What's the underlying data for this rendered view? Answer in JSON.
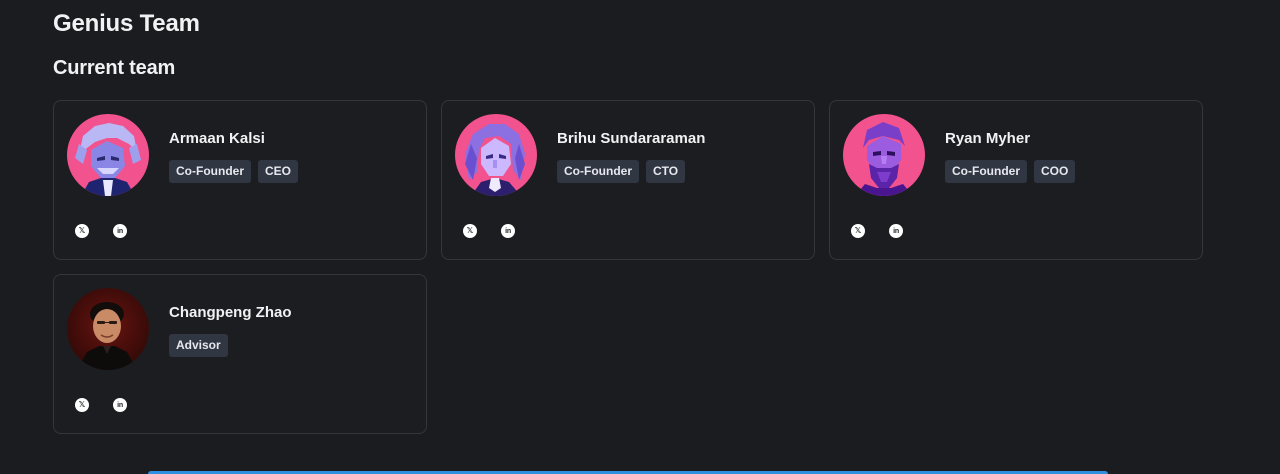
{
  "section_title": "Genius Team",
  "subsection_title": "Current team",
  "team": [
    {
      "name": "Armaan Kalsi",
      "tags": [
        "Co-Founder",
        "CEO"
      ],
      "avatar": "einstein-avatar",
      "socials": [
        "x-icon",
        "linkedin-icon"
      ]
    },
    {
      "name": "Brihu Sundararaman",
      "tags": [
        "Co-Founder",
        "CTO"
      ],
      "avatar": "newton-avatar",
      "socials": [
        "x-icon",
        "linkedin-icon"
      ]
    },
    {
      "name": "Ryan Myher",
      "tags": [
        "Co-Founder",
        "COO"
      ],
      "avatar": "philosopher-avatar",
      "socials": [
        "x-icon",
        "linkedin-icon"
      ]
    },
    {
      "name": "Changpeng Zhao",
      "tags": [
        "Advisor"
      ],
      "avatar": "photo-avatar",
      "socials": [
        "x-icon",
        "linkedin-icon"
      ]
    }
  ],
  "social_glyphs": {
    "x": "𝕏",
    "linkedin": "in"
  },
  "colors": {
    "background": "#1b1c20",
    "card_border": "#34363c",
    "tag_background": "#303642",
    "avatar_pink": "#f2528e",
    "accent_blue": "#2f8fe0"
  }
}
